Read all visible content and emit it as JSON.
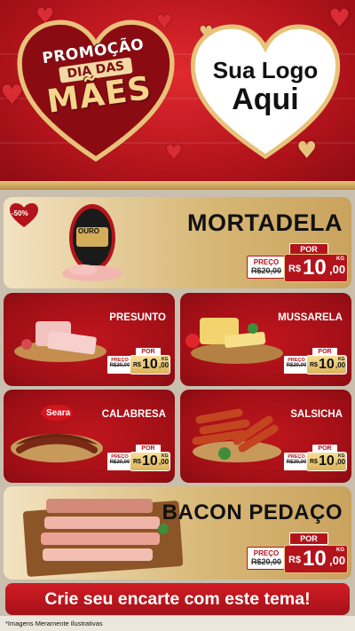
{
  "header": {
    "promo_line1": "PROMOÇÃO",
    "promo_line2": "DIA DAS",
    "promo_line3": "MÃES",
    "logo_line1": "Sua Logo",
    "logo_line2": "Aqui"
  },
  "featured": [
    {
      "name": "MORTADELA",
      "discount": "-50%",
      "brand_label": "OURO",
      "por_label": "POR",
      "preco_label": "PREÇO",
      "old_price": "R$20,00",
      "currency": "R$",
      "price_int": "10",
      "price_dec": ",00",
      "unit": "KG"
    },
    {
      "name": "BACON PEDAÇO",
      "por_label": "POR",
      "preco_label": "PREÇO",
      "old_price": "R$20,00",
      "currency": "R$",
      "price_int": "10",
      "price_dec": ",00",
      "unit": "KG"
    }
  ],
  "products": [
    {
      "name": "PRESUNTO",
      "por_label": "POR",
      "preco_label": "PREÇO",
      "old_price": "R$20,00",
      "currency": "R$",
      "price_int": "10",
      "price_dec": ",00",
      "unit": "KG"
    },
    {
      "name": "MUSSARELA",
      "por_label": "POR",
      "preco_label": "PREÇO",
      "old_price": "R$20,00",
      "currency": "R$",
      "price_int": "10",
      "price_dec": ",00",
      "unit": "KG"
    },
    {
      "name": "CALABRESA",
      "brand_label": "Seara",
      "por_label": "POR",
      "preco_label": "PREÇO",
      "old_price": "R$20,00",
      "currency": "R$",
      "price_int": "10",
      "price_dec": ",00",
      "unit": "KG"
    },
    {
      "name": "SALSICHA",
      "por_label": "POR",
      "preco_label": "PREÇO",
      "old_price": "R$20,00",
      "currency": "R$",
      "price_int": "10",
      "price_dec": ",00",
      "unit": "KG"
    }
  ],
  "footer": {
    "cta": "Crie seu encarte com este tema!",
    "disclaimer": "*Imagens Meramente Ilustrativas"
  },
  "colors": {
    "brand_red": "#b3141b",
    "gold": "#e8c27a",
    "cream": "#f3e3c2"
  },
  "icons": [
    "heart-icon"
  ]
}
